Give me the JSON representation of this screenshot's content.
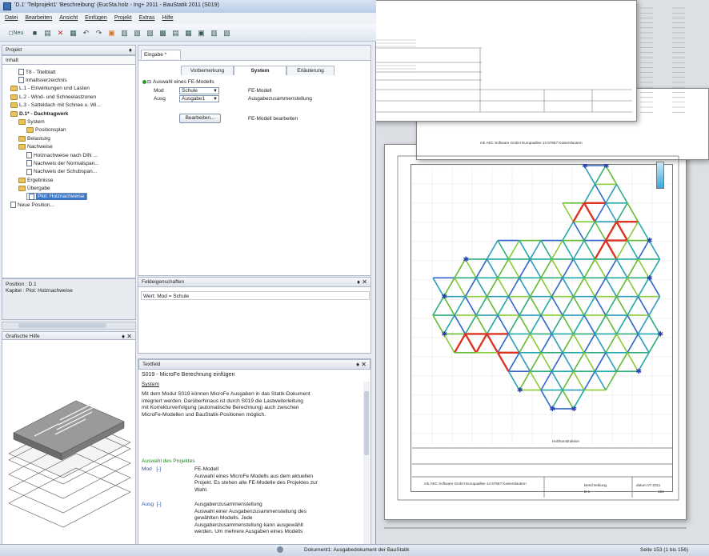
{
  "window": {
    "title": "'D.1' 'Teilprojekt1' 'Beschreibung' (EucSta.holz - Ing+ 2011 - BauStatik 2011 (S019)"
  },
  "menu": [
    "Datei",
    "Bearbeiten",
    "Ansicht",
    "Einfügen",
    "Projekt",
    "Extras",
    "Hilfe"
  ],
  "toolbar": {
    "new_label": "Neu"
  },
  "project_panel": {
    "title": "Projekt",
    "pin": "♦",
    "tab": "Inhalt"
  },
  "tree": [
    {
      "label": "T8 - Titelblatt",
      "indent": 1,
      "type": "doc"
    },
    {
      "label": "Inhaltsverzeichnis",
      "indent": 1,
      "type": "doc"
    },
    {
      "label": "L.1 - Einwirkungen und Lasten",
      "indent": 0,
      "type": "folder"
    },
    {
      "label": "L.2 - Wind- und Schneelastzonen",
      "indent": 0,
      "type": "folder"
    },
    {
      "label": "L.3 - Satteldach mit Schnee u. Wi...",
      "indent": 0,
      "type": "folder"
    },
    {
      "label": "D.1* - Dachtragwerk",
      "indent": 0,
      "type": "folder",
      "bold": true
    },
    {
      "label": "System",
      "indent": 1,
      "type": "folder"
    },
    {
      "label": "Positionsplan",
      "indent": 2,
      "type": "folder"
    },
    {
      "label": "Belastung",
      "indent": 1,
      "type": "folder"
    },
    {
      "label": "Nachweise",
      "indent": 1,
      "type": "folder"
    },
    {
      "label": "Holznachweise nach DIN ...",
      "indent": 2,
      "type": "doc"
    },
    {
      "label": "Nachweis der Normalspan...",
      "indent": 2,
      "type": "doc"
    },
    {
      "label": "Nachweis der Schubspan...",
      "indent": 2,
      "type": "doc"
    },
    {
      "label": "Ergebnisse",
      "indent": 1,
      "type": "folder"
    },
    {
      "label": "Übergabe",
      "indent": 1,
      "type": "folder"
    },
    {
      "label": "Plot: Holznachweise",
      "indent": 2,
      "type": "doc",
      "selected": true
    },
    {
      "label": "Neue Position...",
      "indent": 0,
      "type": "doc"
    }
  ],
  "position": {
    "line1": "Position : D.1",
    "line2": "Kapitel : Plot: Holznachweise"
  },
  "grafik_panel": {
    "title": "Grafische Hilfe",
    "pin": "♦ ✕"
  },
  "eingabe": {
    "tab": "Eingabe *"
  },
  "form_tabs": [
    "Vorbemerkung",
    "System",
    "Erläuterung"
  ],
  "form": {
    "group_title": "Auswahl eines FE-Modells",
    "mod_label": "Mod",
    "mod_value": "Schule",
    "mod_desc": "FE-Modell",
    "ausg_label": "Ausg",
    "ausg_value": "Ausgabe1",
    "ausg_desc": "Ausgabezusammenstellung",
    "button": "Bearbeiten...",
    "button_desc": "FE-Modell bearbeiten"
  },
  "feld_panel": {
    "title": "Feldeigenschaften",
    "pin": "♦ ✕",
    "value": "Wert: Mod = Schule"
  },
  "text_panel": {
    "title": "Textfeld",
    "pin": "♦ ✕",
    "heading": "S019 - MicroFe Berechnung einfügen",
    "system": "System",
    "p1": "Mit dem Modul S019 können MicroFe Ausgaben in das Statik-Dokument\nintegriert werden. Darüberhinaus ist durch S019 die Lastweiterleitung\nmit Korrekturverfolgung (automatische Berechnung) auch zwischen\nMicroFe-Modellen und BauStatik-Positionen möglich.",
    "section": "Auswahl des Projektes",
    "mod": "Mod   [-]",
    "mod_text": "FE-Modell\nAuswahl eines MicroFe Modells aus dem aktuellen\nProjekt. Es stehen alle FE-Modelle des Projektes zur\nWahl.",
    "ausg": "Ausg  [-]",
    "ausg_text": "Ausgabenzusammenstellung\nAuswahl einer Ausgabenzusammenstellung des\ngewählten Modells. Jede\nAusgabenzusammenstellung kann ausgewählt\nwerden. Um mehrere Ausgaben eines Modells"
  },
  "status": {
    "doc": "Dokument1: Ausgabedokument der BauStatik",
    "page": "Seite 153 (1 bis 156)"
  },
  "preview": {
    "footer_company": "mb AEC Software GmbH   Europaallee 14   67657 Kaiserslautern",
    "title_label": "Holzkonstruktion",
    "phase": "Beschreibung",
    "datum": "datum 07.2011",
    "pos": "D.1",
    "seite": "153"
  },
  "colors": {
    "accent": "#3a76c8",
    "mesh_blue": "#3366cc",
    "mesh_green": "#66bb33",
    "mesh_red": "#dd3322",
    "mesh_teal": "#22aaaa"
  }
}
